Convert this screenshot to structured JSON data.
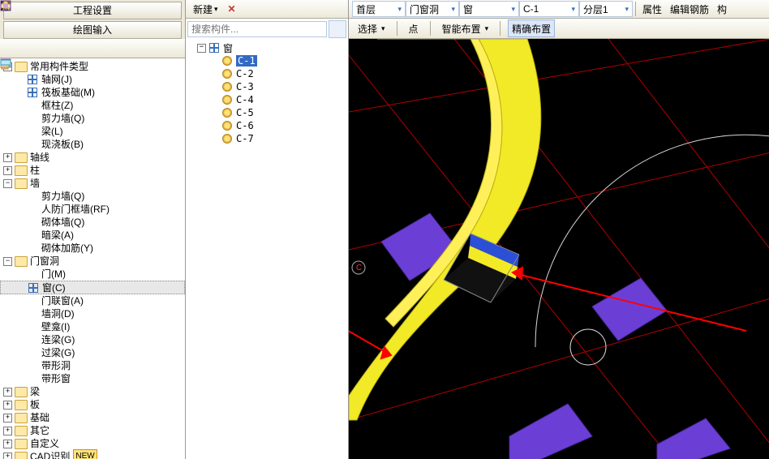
{
  "left_panel": {
    "tabs": {
      "settings": "工程设置",
      "draw": "绘图输入"
    },
    "tree": [
      {
        "lvl": 0,
        "pm": "-",
        "icon": "folder",
        "label": "常用构件类型"
      },
      {
        "lvl": 1,
        "pm": "",
        "icon": "grid-blue",
        "label": "轴网(J)"
      },
      {
        "lvl": 1,
        "pm": "",
        "icon": "grid-blue",
        "label": "筏板基础(M)"
      },
      {
        "lvl": 1,
        "pm": "",
        "icon": "col-cyan",
        "label": "框柱(Z)"
      },
      {
        "lvl": 1,
        "pm": "",
        "icon": "wall-cyan",
        "label": "剪力墙(Q)"
      },
      {
        "lvl": 1,
        "pm": "",
        "icon": "beam-green",
        "label": "梁(L)"
      },
      {
        "lvl": 1,
        "pm": "",
        "icon": "slab",
        "label": "现浇板(B)"
      },
      {
        "lvl": 0,
        "pm": "+",
        "icon": "folder",
        "label": "轴线"
      },
      {
        "lvl": 0,
        "pm": "+",
        "icon": "folder",
        "label": "柱"
      },
      {
        "lvl": 0,
        "pm": "-",
        "icon": "folder",
        "label": "墙"
      },
      {
        "lvl": 1,
        "pm": "",
        "icon": "wall-cyan",
        "label": "剪力墙(Q)"
      },
      {
        "lvl": 1,
        "pm": "",
        "icon": "wall-or",
        "label": "人防门框墙(RF)"
      },
      {
        "lvl": 1,
        "pm": "",
        "icon": "wall-or",
        "label": "砌体墙(Q)"
      },
      {
        "lvl": 1,
        "pm": "",
        "icon": "beam-blue",
        "label": "暗梁(A)"
      },
      {
        "lvl": 1,
        "pm": "",
        "icon": "rebar",
        "label": "砌体加筋(Y)"
      },
      {
        "lvl": 0,
        "pm": "-",
        "icon": "folder",
        "label": "门窗洞"
      },
      {
        "lvl": 1,
        "pm": "",
        "icon": "door",
        "label": "门(M)"
      },
      {
        "lvl": 1,
        "pm": "",
        "icon": "window",
        "label": "窗(C)",
        "sel": true
      },
      {
        "lvl": 1,
        "pm": "",
        "icon": "dwin",
        "label": "门联窗(A)"
      },
      {
        "lvl": 1,
        "pm": "",
        "icon": "hole",
        "label": "墙洞(D)"
      },
      {
        "lvl": 1,
        "pm": "",
        "icon": "niche",
        "label": "壁龛(I)"
      },
      {
        "lvl": 1,
        "pm": "",
        "icon": "lintel",
        "label": "连梁(G)"
      },
      {
        "lvl": 1,
        "pm": "",
        "icon": "lintel",
        "label": "过梁(G)"
      },
      {
        "lvl": 1,
        "pm": "",
        "icon": "shape",
        "label": "带形洞"
      },
      {
        "lvl": 1,
        "pm": "",
        "icon": "shape",
        "label": "带形窗"
      },
      {
        "lvl": 0,
        "pm": "+",
        "icon": "folder",
        "label": "梁"
      },
      {
        "lvl": 0,
        "pm": "+",
        "icon": "folder",
        "label": "板"
      },
      {
        "lvl": 0,
        "pm": "+",
        "icon": "folder",
        "label": "基础"
      },
      {
        "lvl": 0,
        "pm": "+",
        "icon": "folder",
        "label": "其它"
      },
      {
        "lvl": 0,
        "pm": "+",
        "icon": "folder",
        "label": "自定义"
      },
      {
        "lvl": 0,
        "pm": "+",
        "icon": "folder",
        "label": "CAD识别",
        "new": true
      }
    ]
  },
  "mid_panel": {
    "toolbar": {
      "new": "新建",
      "close": "✕",
      "copy": "⧉"
    },
    "search_placeholder": "搜索构件...",
    "root": "窗",
    "items": [
      "C-1",
      "C-2",
      "C-3",
      "C-4",
      "C-5",
      "C-6",
      "C-7"
    ],
    "selected": "C-1"
  },
  "right_panel": {
    "crumbs": {
      "floor": "首层",
      "cat": "门窗洞",
      "type": "窗",
      "comp": "C-1",
      "layer": "分层1"
    },
    "btns": {
      "attr": "属性",
      "editrebar": "编辑钢筋",
      "cfg": "构"
    },
    "tb2": {
      "select": "选择",
      "point": "点",
      "smart": "智能布置",
      "precise": "精确布置"
    }
  }
}
